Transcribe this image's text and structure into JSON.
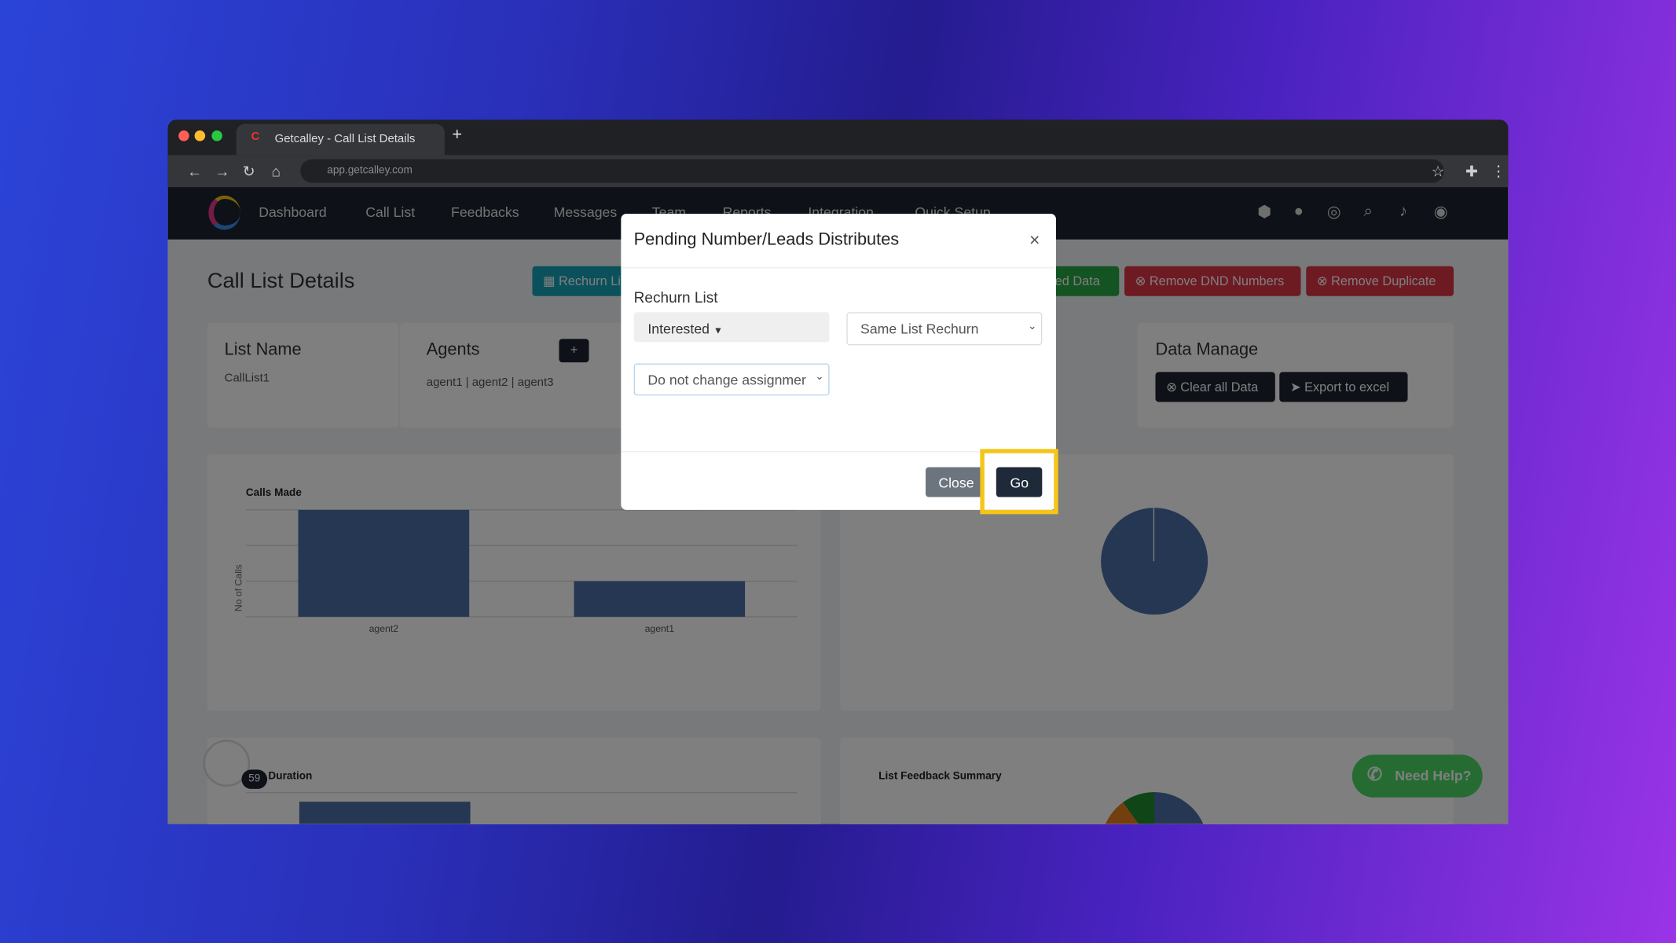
{
  "browser": {
    "tab_title": "Getcalley - Call List Details",
    "new_tab": "+",
    "url": "app.getcalley.com",
    "icons": [
      "back-icon",
      "forward-icon",
      "reload-icon",
      "home-icon",
      "star-icon",
      "extensions-icon",
      "menu-icon"
    ]
  },
  "nav": {
    "items": [
      "Dashboard",
      "Call List",
      "Feedbacks",
      "Messages",
      "Team",
      "Reports",
      "Integration",
      "Quick Setup"
    ],
    "right_icons": [
      "android-icon",
      "apple-icon",
      "support-icon",
      "search-icon",
      "bell-icon",
      "user-icon"
    ]
  },
  "page": {
    "title": "Call List Details",
    "buttons": {
      "rechurn": "Rechurn List",
      "assigned": "Unassigned Data",
      "remove_dnd": "Remove DND Numbers",
      "remove_dup": "Remove Duplicate"
    },
    "list_name": {
      "title": "List Name",
      "value": "CallList1"
    },
    "agents": {
      "title": "Agents",
      "value": "agent1 | agent2 | agent3"
    },
    "data_manage": {
      "title": "Data Manage",
      "clear": "Clear all Data",
      "export": "Export to excel"
    },
    "duration_title": "Duration",
    "feedback_title": "List Feedback Summary",
    "badge_count": "59",
    "help": "Need Help?"
  },
  "modal": {
    "title": "Pending Number/Leads Distributes",
    "close_x": "×",
    "label": "Rechurn List",
    "status": "Interested",
    "rechurn_type": "Same List Rechurn",
    "assign": "Do not change assignmer",
    "close": "Close",
    "go": "Go"
  },
  "colors": {
    "highlight": "#f5c518",
    "bar": "#4a6fa5",
    "nav": "#1c2331",
    "danger": "#dc3545",
    "success": "#28a745",
    "info": "#17a2b8"
  },
  "chart_data": {
    "type": "bar",
    "title": "Calls Made",
    "ylabel": "No of Calls",
    "categories": [
      "agent2",
      "agent1"
    ],
    "values": [
      3,
      1
    ],
    "grid": true
  }
}
